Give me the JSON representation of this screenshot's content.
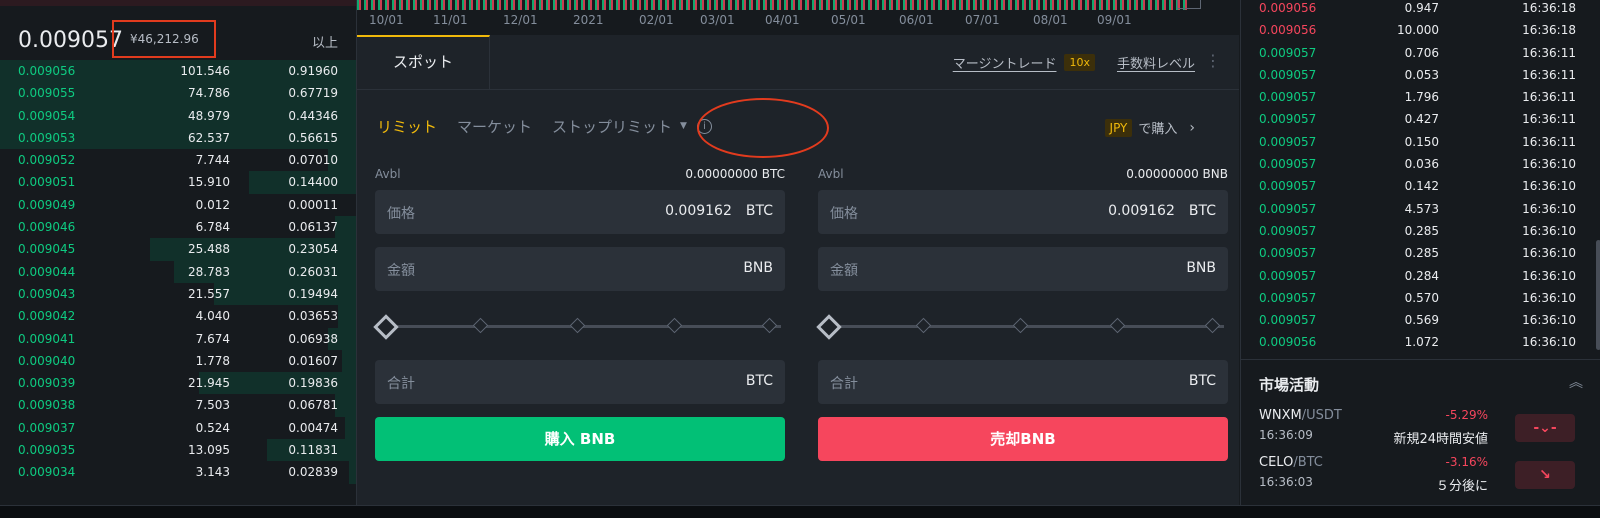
{
  "orderbook": {
    "last_price": "0.009057",
    "fiat_price": "¥46,212.96",
    "more_label": "以上",
    "bids": [
      {
        "price": "0.009056",
        "amount": "101.546",
        "total": "0.91960",
        "depth": 1.0
      },
      {
        "price": "0.009055",
        "amount": "74.786",
        "total": "0.67719",
        "depth": 1.0
      },
      {
        "price": "0.009054",
        "amount": "48.979",
        "total": "0.44346",
        "depth": 1.0
      },
      {
        "price": "0.009053",
        "amount": "62.537",
        "total": "0.56615",
        "depth": 1.0
      },
      {
        "price": "0.009052",
        "amount": "7.744",
        "total": "0.07010",
        "depth": 0.08
      },
      {
        "price": "0.009051",
        "amount": "15.910",
        "total": "0.14400",
        "depth": 0.3
      },
      {
        "price": "0.009049",
        "amount": "0.012",
        "total": "0.00011",
        "depth": 0.0
      },
      {
        "price": "0.009046",
        "amount": "6.784",
        "total": "0.06137",
        "depth": 0.06
      },
      {
        "price": "0.009045",
        "amount": "25.488",
        "total": "0.23054",
        "depth": 0.58
      },
      {
        "price": "0.009044",
        "amount": "28.783",
        "total": "0.26031",
        "depth": 0.51
      },
      {
        "price": "0.009043",
        "amount": "21.557",
        "total": "0.19494",
        "depth": 0.4
      },
      {
        "price": "0.009042",
        "amount": "4.040",
        "total": "0.03653",
        "depth": 0.05
      },
      {
        "price": "0.009041",
        "amount": "7.674",
        "total": "0.06938",
        "depth": 0.08
      },
      {
        "price": "0.009040",
        "amount": "1.778",
        "total": "0.01607",
        "depth": 0.04
      },
      {
        "price": "0.009039",
        "amount": "21.945",
        "total": "0.19836",
        "depth": 0.44
      },
      {
        "price": "0.009038",
        "amount": "7.503",
        "total": "0.06781",
        "depth": 0.06
      },
      {
        "price": "0.009037",
        "amount": "0.524",
        "total": "0.00474",
        "depth": 0.03
      },
      {
        "price": "0.009035",
        "amount": "13.095",
        "total": "0.11831",
        "depth": 0.25
      },
      {
        "price": "0.009034",
        "amount": "3.143",
        "total": "0.02839",
        "depth": 0.02
      }
    ]
  },
  "chart": {
    "dates": [
      "10/01",
      "11/01",
      "12/01",
      "2021",
      "02/01",
      "03/01",
      "04/01",
      "05/01",
      "06/01",
      "07/01",
      "08/01",
      "09/01"
    ]
  },
  "tabs": {
    "spot": "スポット",
    "margin_trade": "マージントレード",
    "leverage": "10x",
    "fee_level": "手数料レベル"
  },
  "order_types": {
    "limit": "リミット",
    "market": "マーケット",
    "stop_limit": "ストップリミット",
    "fiat_currency": "JPY",
    "fiat_buy": "で購入"
  },
  "buy": {
    "avbl_label": "Avbl",
    "avbl_value": "0.00000000 BTC",
    "price_label": "価格",
    "price_value": "0.009162",
    "price_unit": "BTC",
    "amount_label": "金額",
    "amount_unit": "BNB",
    "total_label": "合計",
    "total_unit": "BTC",
    "button": "購入 BNB"
  },
  "sell": {
    "avbl_label": "Avbl",
    "avbl_value": "0.00000000 BNB",
    "price_label": "価格",
    "price_value": "0.009162",
    "price_unit": "BTC",
    "amount_label": "金額",
    "amount_unit": "BNB",
    "total_label": "合計",
    "total_unit": "BTC",
    "button": "売却BNB"
  },
  "trades": [
    {
      "price": "0.009056",
      "qty": "0.947",
      "time": "16:36:18",
      "side": "down"
    },
    {
      "price": "0.009056",
      "qty": "10.000",
      "time": "16:36:18",
      "side": "down"
    },
    {
      "price": "0.009057",
      "qty": "0.706",
      "time": "16:36:11",
      "side": "up"
    },
    {
      "price": "0.009057",
      "qty": "0.053",
      "time": "16:36:11",
      "side": "up"
    },
    {
      "price": "0.009057",
      "qty": "1.796",
      "time": "16:36:11",
      "side": "up"
    },
    {
      "price": "0.009057",
      "qty": "0.427",
      "time": "16:36:11",
      "side": "up"
    },
    {
      "price": "0.009057",
      "qty": "0.150",
      "time": "16:36:11",
      "side": "up"
    },
    {
      "price": "0.009057",
      "qty": "0.036",
      "time": "16:36:10",
      "side": "up"
    },
    {
      "price": "0.009057",
      "qty": "0.142",
      "time": "16:36:10",
      "side": "up"
    },
    {
      "price": "0.009057",
      "qty": "4.573",
      "time": "16:36:10",
      "side": "up"
    },
    {
      "price": "0.009057",
      "qty": "0.285",
      "time": "16:36:10",
      "side": "up"
    },
    {
      "price": "0.009057",
      "qty": "0.285",
      "time": "16:36:10",
      "side": "up"
    },
    {
      "price": "0.009057",
      "qty": "0.284",
      "time": "16:36:10",
      "side": "up"
    },
    {
      "price": "0.009057",
      "qty": "0.570",
      "time": "16:36:10",
      "side": "up"
    },
    {
      "price": "0.009057",
      "qty": "0.569",
      "time": "16:36:10",
      "side": "up"
    },
    {
      "price": "0.009056",
      "qty": "1.072",
      "time": "16:36:10",
      "side": "up"
    }
  ],
  "market_activity": {
    "title": "市場活動",
    "items": [
      {
        "base": "WNXM",
        "quote": "/USDT",
        "time": "16:36:09",
        "change": "-5.29%",
        "desc": "新規24時間安値",
        "icon": "new-low-icon"
      },
      {
        "base": "CELO",
        "quote": "/BTC",
        "time": "16:36:03",
        "change": "-3.16%",
        "desc": "５分後に",
        "icon": "arrow-down-right-icon"
      }
    ]
  },
  "colors": {
    "up": "#0ecb81",
    "down": "#f6465d",
    "accent": "#f0b90b",
    "annotation": "#e23b1e"
  }
}
